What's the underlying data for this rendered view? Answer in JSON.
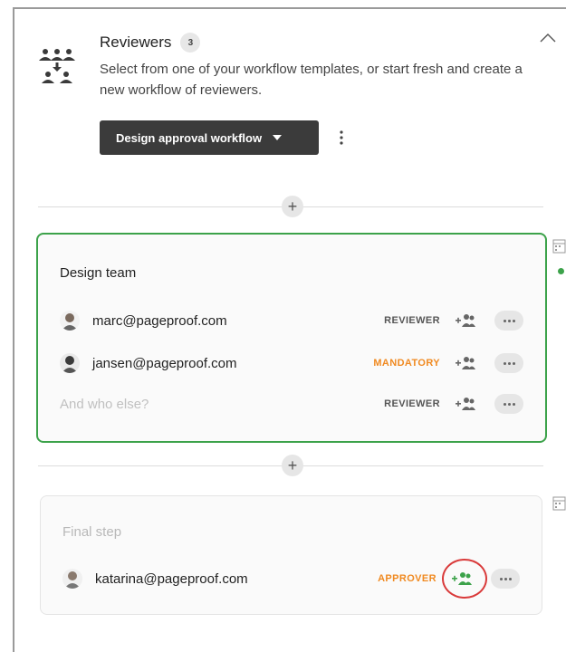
{
  "header": {
    "title": "Reviewers",
    "count": "3",
    "subtitle": "Select from one of your workflow templates, or start fresh and create a new workflow of reviewers.",
    "workflow_button_label": "Design approval workflow"
  },
  "separators": [
    {
      "symbol": "+"
    },
    {
      "symbol": "+"
    }
  ],
  "steps": [
    {
      "title": "Design team",
      "rows": [
        {
          "email": "marc@pageproof.com",
          "role": "REVIEWER"
        },
        {
          "email": "jansen@pageproof.com",
          "role": "MANDATORY"
        },
        {
          "placeholder": "And who else?",
          "role": "REVIEWER"
        }
      ]
    },
    {
      "title": "Final step",
      "rows": [
        {
          "email": "katarina@pageproof.com",
          "role": "APPROVER"
        }
      ]
    }
  ],
  "colors": {
    "active_border": "#3ca24a",
    "accent_orange": "#f08a21",
    "highlight_ring": "#d93a3a",
    "dark_button": "#3b3b3b"
  },
  "icons": {
    "header": "people-workflow-icon",
    "collapse": "chevron-up-icon",
    "menu": "kebab-menu-icon",
    "add_person": "add-people-icon",
    "more": "ellipsis-icon",
    "side": "calendar-icon"
  }
}
